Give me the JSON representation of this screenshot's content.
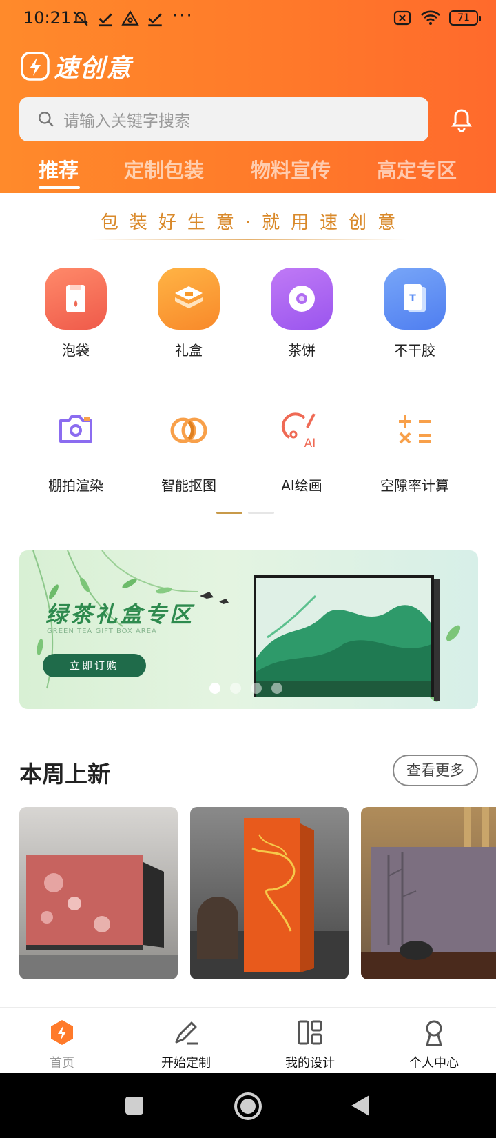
{
  "status_bar": {
    "time": "10:21",
    "more": "···",
    "battery": "71"
  },
  "brand": {
    "name": "速创意"
  },
  "search": {
    "placeholder": "请输入关键字搜索"
  },
  "tabs": [
    {
      "label": "推荐",
      "active": true
    },
    {
      "label": "定制包装"
    },
    {
      "label": "物料宣传"
    },
    {
      "label": "高定专区"
    }
  ],
  "slogan": "包装好生意·就用速创意",
  "categories": [
    {
      "label": "泡袋",
      "icon": "tea-bag-icon",
      "color": "#f46b55"
    },
    {
      "label": "礼盒",
      "icon": "gift-box-icon",
      "color": "#f89a2c"
    },
    {
      "label": "茶饼",
      "icon": "tea-cake-icon",
      "color": "#a861ef"
    },
    {
      "label": "不干胶",
      "icon": "sticker-icon",
      "color": "#5d8ff5"
    }
  ],
  "tools": [
    {
      "label": "棚拍渲染",
      "icon": "camera-icon"
    },
    {
      "label": "智能抠图",
      "icon": "cutout-icon"
    },
    {
      "label": "AI绘画",
      "icon": "ai-paint-icon"
    },
    {
      "label": "空隙率计算",
      "icon": "calculator-icon"
    }
  ],
  "banner": {
    "title": "绿茶礼盒专区",
    "subtitle": "GREEN TEA GIFT BOX AREA",
    "button": "立即订购"
  },
  "new_section": {
    "title": "本周上新",
    "more": "查看更多"
  },
  "products": [
    {
      "name": "pink-floral-gift-box"
    },
    {
      "name": "orange-phoenix-tea-box"
    },
    {
      "name": "purple-bamboo-white-tea-box"
    }
  ],
  "bottom_nav": [
    {
      "label": "首页",
      "icon": "home-icon",
      "active": true
    },
    {
      "label": "开始定制",
      "icon": "pen-icon"
    },
    {
      "label": "我的设计",
      "icon": "layout-icon"
    },
    {
      "label": "个人中心",
      "icon": "user-icon"
    }
  ],
  "colors": {
    "brand_orange": "#ff7a2a",
    "slogan": "#d9892a",
    "banner_green": "#2e8a4e"
  }
}
